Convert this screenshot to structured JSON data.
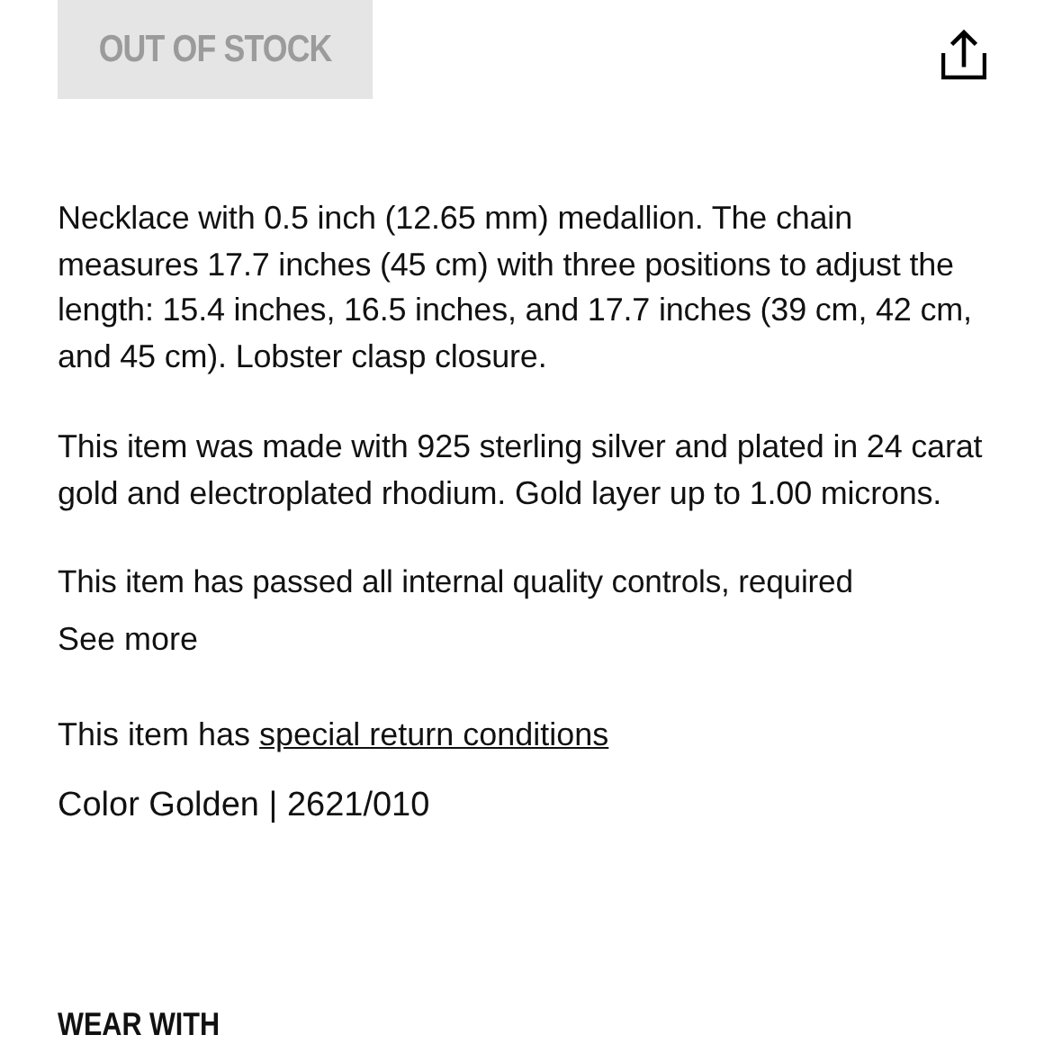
{
  "stock_button": {
    "label": "OUT OF STOCK",
    "disabled": true
  },
  "description": [
    "Necklace with 0.5 inch (12.65 mm) medallion. The chain measures 17.7 inches (45 cm) with three positions to adjust the length: 15.4 inches, 16.5 inches, and 17.7 inches (39 cm, 42 cm, and 45 cm). Lobster clasp closure.",
    "This item was made with 925 sterling silver and plated in 24 carat gold and electroplated rhodium. Gold layer up to 1.00 microns."
  ],
  "truncated_text": "This item has passed all internal quality controls, required",
  "see_more": "See more",
  "returns": {
    "text": "This item has",
    "link": "special return conditions"
  },
  "color_ref": "Color Golden | 2621/010",
  "section_heading": "WEAR WITH"
}
